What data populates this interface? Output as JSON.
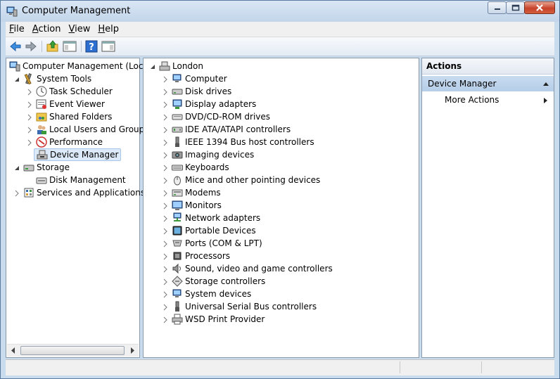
{
  "window": {
    "title": "Computer Management",
    "buttons": [
      "minimize-icon",
      "maximize-icon",
      "close-icon"
    ]
  },
  "menu": [
    {
      "accel": "F",
      "rest": "ile"
    },
    {
      "accel": "A",
      "rest": "ction"
    },
    {
      "accel": "V",
      "rest": "iew"
    },
    {
      "accel": "H",
      "rest": "elp"
    }
  ],
  "toolbar": {
    "icons": [
      "back-arrow-icon",
      "forward-arrow-icon",
      "up-folder-icon",
      "show-hide-console-tree-icon",
      "help-icon",
      "show-hide-action-pane-icon"
    ]
  },
  "tree": {
    "root": "Computer Management (Local",
    "system_tools": "System Tools",
    "task_scheduler": "Task Scheduler",
    "event_viewer": "Event Viewer",
    "shared_folders": "Shared Folders",
    "local_users": "Local Users and Groups",
    "performance": "Performance",
    "device_manager": "Device Manager",
    "storage": "Storage",
    "disk_management": "Disk Management",
    "services": "Services and Applications"
  },
  "devices": {
    "root": "London",
    "categories": [
      "Computer",
      "Disk drives",
      "Display adapters",
      "DVD/CD-ROM drives",
      "IDE ATA/ATAPI controllers",
      "IEEE 1394 Bus host controllers",
      "Imaging devices",
      "Keyboards",
      "Mice and other pointing devices",
      "Modems",
      "Monitors",
      "Network adapters",
      "Portable Devices",
      "Ports (COM & LPT)",
      "Processors",
      "Sound, video and game controllers",
      "Storage controllers",
      "System devices",
      "Universal Serial Bus controllers",
      "WSD Print Provider"
    ]
  },
  "actions": {
    "header": "Actions",
    "section": "Device Manager",
    "more": "More Actions"
  }
}
